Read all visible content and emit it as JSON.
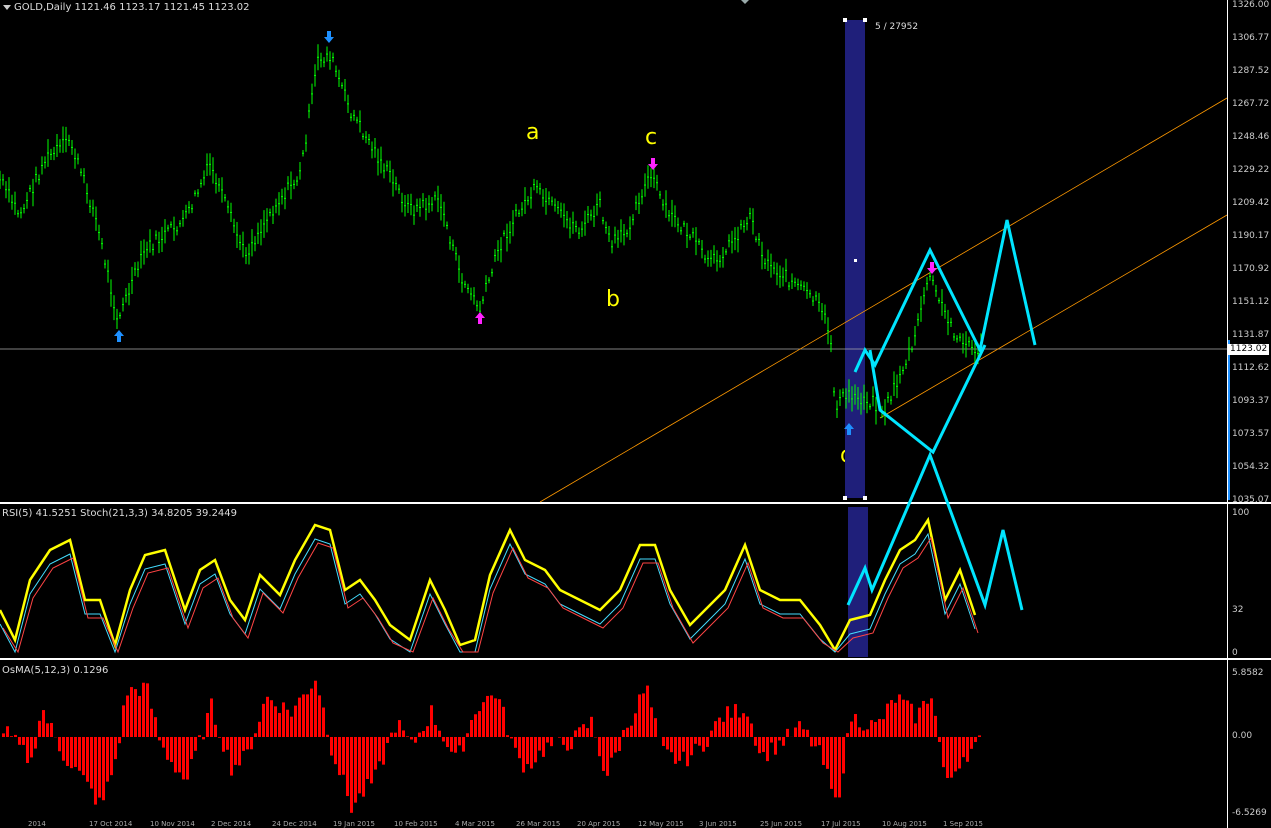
{
  "chart": {
    "header": "GOLD,Daily  1121.46 1123.17 1121.45 1123.02",
    "bar_count_label": "5 / 27952",
    "current_price": "1123.02",
    "price_axis": [
      "1326.00",
      "1306.77",
      "1287.52",
      "1267.72",
      "1248.46",
      "1229.22",
      "1209.42",
      "1190.17",
      "1170.92",
      "1151.12",
      "1131.87",
      "1112.62",
      "1093.37",
      "1073.57",
      "1054.32",
      "1035.07"
    ],
    "wave_labels": {
      "a": "a",
      "b": "b",
      "c": "c",
      "d": "d"
    },
    "colors": {
      "bull": "#00ff00",
      "bear": "#00ff00",
      "projection": "#00e5ff",
      "channel": "#ff9900",
      "highlight": "#1f1f7a",
      "rsi": "#ffff00",
      "osma": "#ff0000"
    }
  },
  "indicator1": {
    "title": "RSI(5) 41.5251  Stoch(21,3,3) 34.8205 39.2449",
    "axis": [
      "100",
      "32",
      "0"
    ]
  },
  "indicator2": {
    "title": "OsMA(5,12,3) 0.1296",
    "axis": [
      "5.8582",
      "0.00",
      "-6.5269"
    ]
  },
  "dates": [
    "2014",
    "17 Oct 2014",
    "10 Nov 2014",
    "2 Dec 2014",
    "24 Dec 2014",
    "19 Jan 2015",
    "10 Feb 2015",
    "4 Mar 2015",
    "26 Mar 2015",
    "20 Apr 2015",
    "12 May 2015",
    "3 Jun 2015",
    "25 Jun 2015",
    "17 Jul 2015",
    "10 Aug 2015",
    "1 Sep 2015"
  ]
}
